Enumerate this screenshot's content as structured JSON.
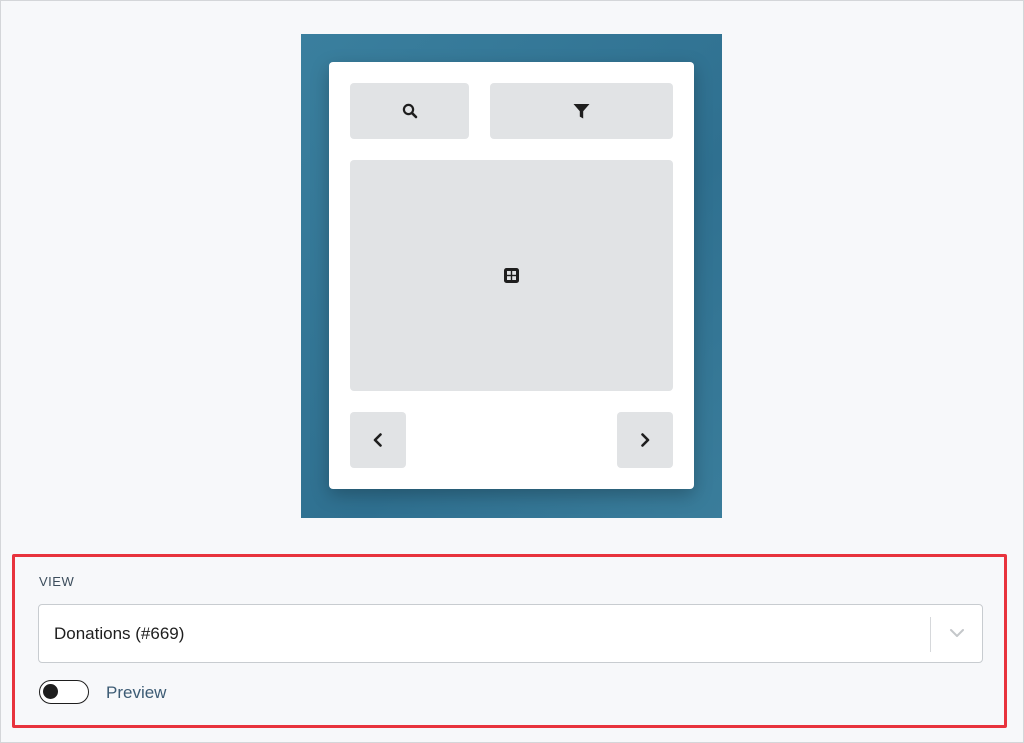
{
  "preview": {
    "background_color": "#35789a",
    "block_color": "#e1e3e5",
    "icons": {
      "search": "search-icon",
      "filter": "filter-icon",
      "grid": "grid-icon",
      "prev": "chevron-left-icon",
      "next": "chevron-right-icon"
    }
  },
  "view_panel": {
    "label": "VIEW",
    "highlight_color": "#e8333d",
    "select": {
      "value": "Donations (#669)",
      "icon": "chevron-down-icon"
    },
    "preview_toggle": {
      "label": "Preview",
      "checked": false
    }
  }
}
